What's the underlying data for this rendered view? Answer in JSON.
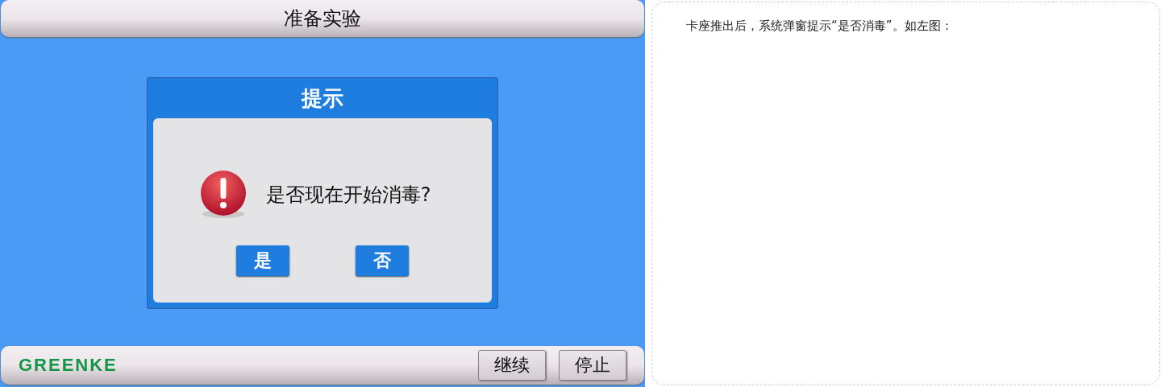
{
  "screen": {
    "title": "准备实验",
    "dialog": {
      "title": "提示",
      "message": "是否现在开始消毒?",
      "buttons": [
        "是",
        "否"
      ]
    },
    "footer": {
      "logo": "GREENKE",
      "buttons": [
        "继续",
        "停止"
      ]
    }
  },
  "note": {
    "text": "卡座推出后，系统弹窗提示“是否消毒”。如左图："
  }
}
